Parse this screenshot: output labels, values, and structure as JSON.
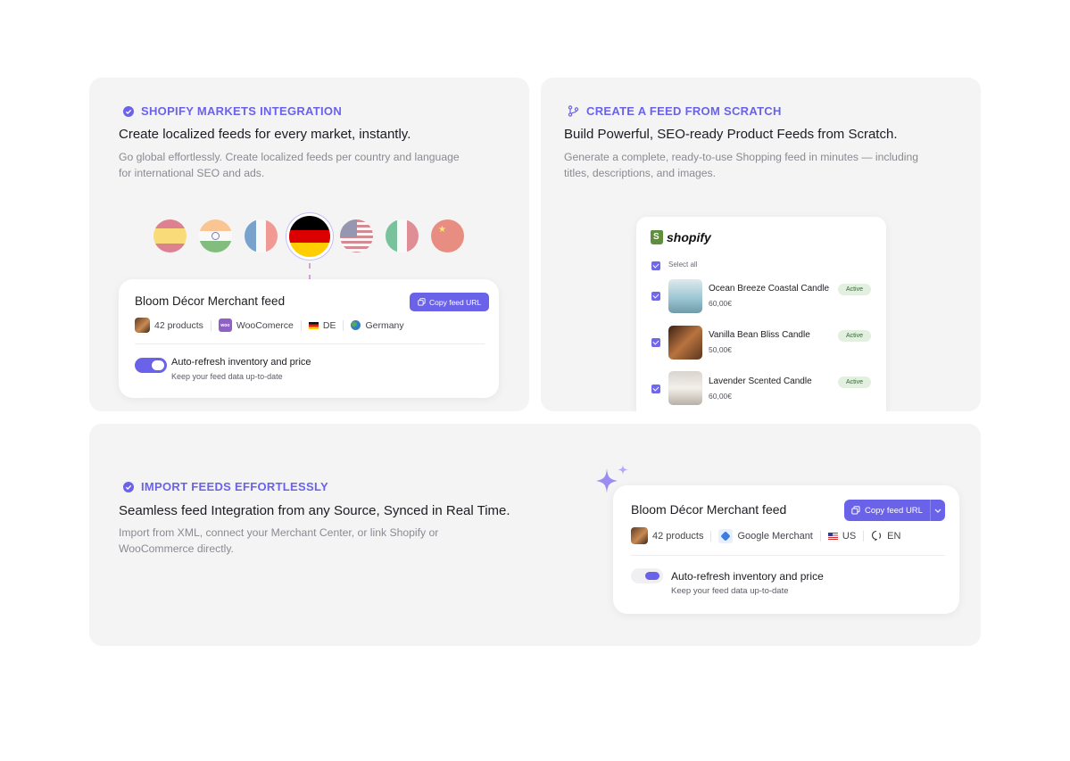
{
  "card1": {
    "eyebrow": "SHOPIFY MARKETS INTEGRATION",
    "heading": "Create localized feeds for every market, instantly.",
    "description": "Go global effortlessly. Create localized feeds per country and language for international SEO and ads.",
    "flags": [
      "spain-flag",
      "india-flag",
      "france-flag",
      "germany-flag",
      "usa-flag",
      "italy-flag",
      "china-flag"
    ],
    "active_flag": "germany-flag",
    "feed": {
      "title": "Bloom Décor Merchant feed",
      "copy_label": "Copy feed URL",
      "products": "42 products",
      "platform": "WooComerce",
      "platform_icon_text": "woo",
      "country_code": "DE",
      "country": "Germany",
      "toggle_title": "Auto-refresh inventory and price",
      "toggle_sub": "Keep your feed data up-to-date",
      "toggle_on": true
    }
  },
  "card2": {
    "eyebrow": "CREATE A FEED FROM SCRATCH",
    "heading": "Build Powerful, SEO-ready Product Feeds from Scratch.",
    "description": "Generate a complete, ready-to-use Shopping feed in minutes — including titles, descriptions, and images.",
    "shop": {
      "logo": "shopify",
      "select_all": "Select all",
      "products": [
        {
          "name": "Ocean Breeze Coastal Candle",
          "price": "60,00€",
          "status": "Active"
        },
        {
          "name": "Vanilla Bean Bliss Candle",
          "price": "50,00€",
          "status": "Active"
        },
        {
          "name": "Lavender Scented Candle",
          "price": "60,00€",
          "status": "Active"
        }
      ]
    }
  },
  "card3": {
    "eyebrow": "IMPORT FEEDS EFFORTLESSLY",
    "heading": "Seamless feed Integration from any Source, Synced in Real Time.",
    "description": "Import from XML, connect your Merchant Center, or link Shopify or WooCommerce directly.",
    "feed": {
      "title": "Bloom Décor Merchant feed",
      "copy_label": "Copy feed URL",
      "products": "42 products",
      "platform": "Google Merchant",
      "country_code": "US",
      "language": "EN",
      "toggle_title": "Auto-refresh inventory and price",
      "toggle_sub": "Keep your feed data up-to-date",
      "toggle_on": true
    }
  },
  "colors": {
    "accent": "#6a62e8",
    "card_bg": "#f4f4f5",
    "badge_bg": "#e3efdf",
    "badge_text": "#2d6b32"
  }
}
